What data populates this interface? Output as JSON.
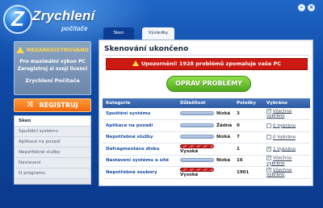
{
  "app": {
    "title": "Zrychlení",
    "subtitle": "počítače",
    "logo_letter": "Z"
  },
  "window_controls": [
    "minimize",
    "close"
  ],
  "sidebar": {
    "unregistered": {
      "heading": "NEZAREGISTROVÁNO",
      "line1": "Pro maximální výkon PC",
      "line2": "Zaregistruj si svoji licenci",
      "brand": "Zrychlení Počítače"
    },
    "register_button": "REGISTRUJ",
    "items": [
      {
        "label": "Sken",
        "active": true
      },
      {
        "label": "Spuštění systému",
        "active": false
      },
      {
        "label": "Aplikace na pozadí",
        "active": false
      },
      {
        "label": "Nepotřebné služby",
        "active": false
      },
      {
        "label": "Nastavení",
        "active": false
      },
      {
        "label": "O programu",
        "active": false
      }
    ]
  },
  "tabs": [
    {
      "label": "Sken",
      "active": true
    },
    {
      "label": "Výsledky",
      "active": false
    }
  ],
  "main": {
    "title": "Skenování ukončeno",
    "alert": "Upozornění! 1928 problémů zpomaluje vaše PC",
    "fix_button": "OPRAV PROBLÉMY",
    "table": {
      "headers": [
        "Kategorie",
        "Důležitost",
        "Položky",
        "Vybráno"
      ],
      "rows": [
        {
          "category": "Spuštění systému",
          "importance": "Nízká",
          "level": "low",
          "count": "3",
          "checked": true,
          "selected": "Všechno vybráno"
        },
        {
          "category": "Aplikace na pozadí",
          "importance": "Žádná",
          "level": "none",
          "count": "0",
          "checked": false,
          "selected": "0 Vybráno"
        },
        {
          "category": "Nepotřebné služby",
          "importance": "Nízká",
          "level": "low",
          "count": "7",
          "checked": false,
          "selected": "0 Vybráno"
        },
        {
          "category": "Defragmentace disku",
          "importance": "Vysoká",
          "level": "high",
          "count": "1",
          "checked": true,
          "selected": "1 Vybráno"
        },
        {
          "category": "Nastavení systému a sítě",
          "importance": "Nízká",
          "level": "low",
          "count": "16",
          "checked": true,
          "selected": "Všechno vybráno"
        },
        {
          "category": "Nepotřebné soubory",
          "importance": "Vysoká",
          "level": "high",
          "count": "1901",
          "checked": true,
          "selected": "Všechno vybráno"
        }
      ]
    }
  }
}
